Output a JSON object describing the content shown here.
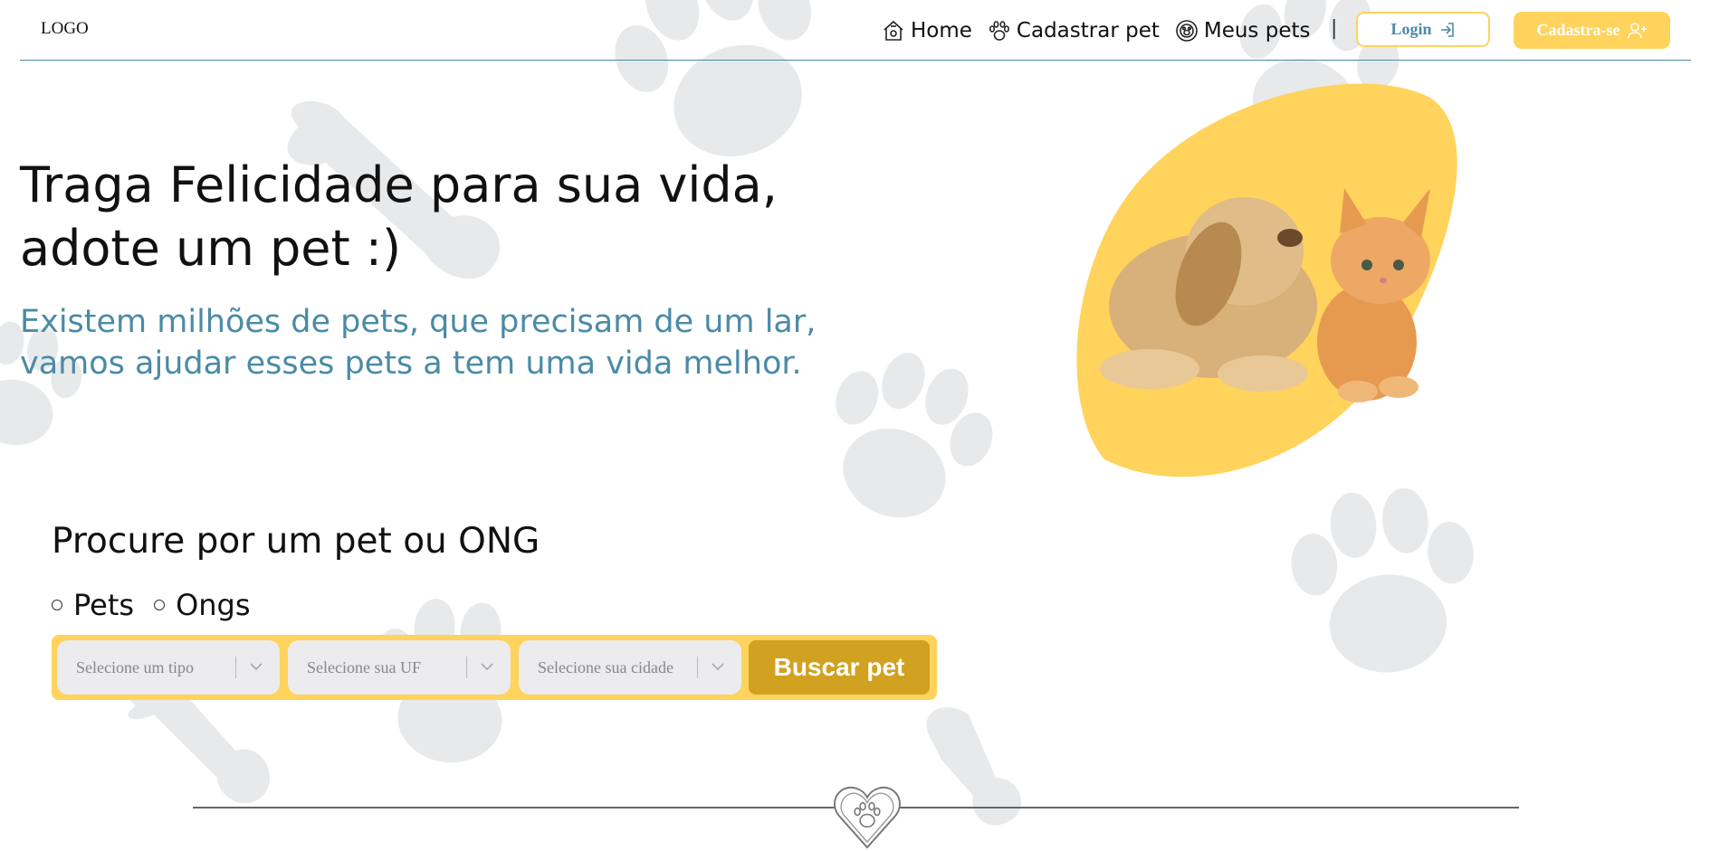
{
  "header": {
    "logo": "LOGO",
    "nav": [
      {
        "label": "Home",
        "icon": "house-icon"
      },
      {
        "label": "Cadastrar pet",
        "icon": "paw-icon"
      },
      {
        "label": "Meus pets",
        "icon": "pet-badge-icon"
      }
    ],
    "separator": "|",
    "login_label": "Login",
    "signup_label": "Cadastra-se"
  },
  "hero": {
    "title": "Traga Felicidade para sua vida, adote um pet :)",
    "subtitle": "Existem milhões de pets, que precisam de um lar, vamos ajudar esses pets a tem uma vida melhor."
  },
  "search": {
    "title": "Procure por um pet ou ONG",
    "radio_options": [
      "Pets",
      "Ongs"
    ],
    "selects": [
      {
        "placeholder": "Selecione um tipo"
      },
      {
        "placeholder": "Selecione sua UF"
      },
      {
        "placeholder": "Selecione sua cidade"
      }
    ],
    "button_label": "Buscar pet"
  },
  "colors": {
    "accent_yellow": "#ffd35c",
    "button_gold": "#d1a120",
    "text_blue": "#4a8ba6",
    "paw_gray": "#e8e9ea"
  }
}
